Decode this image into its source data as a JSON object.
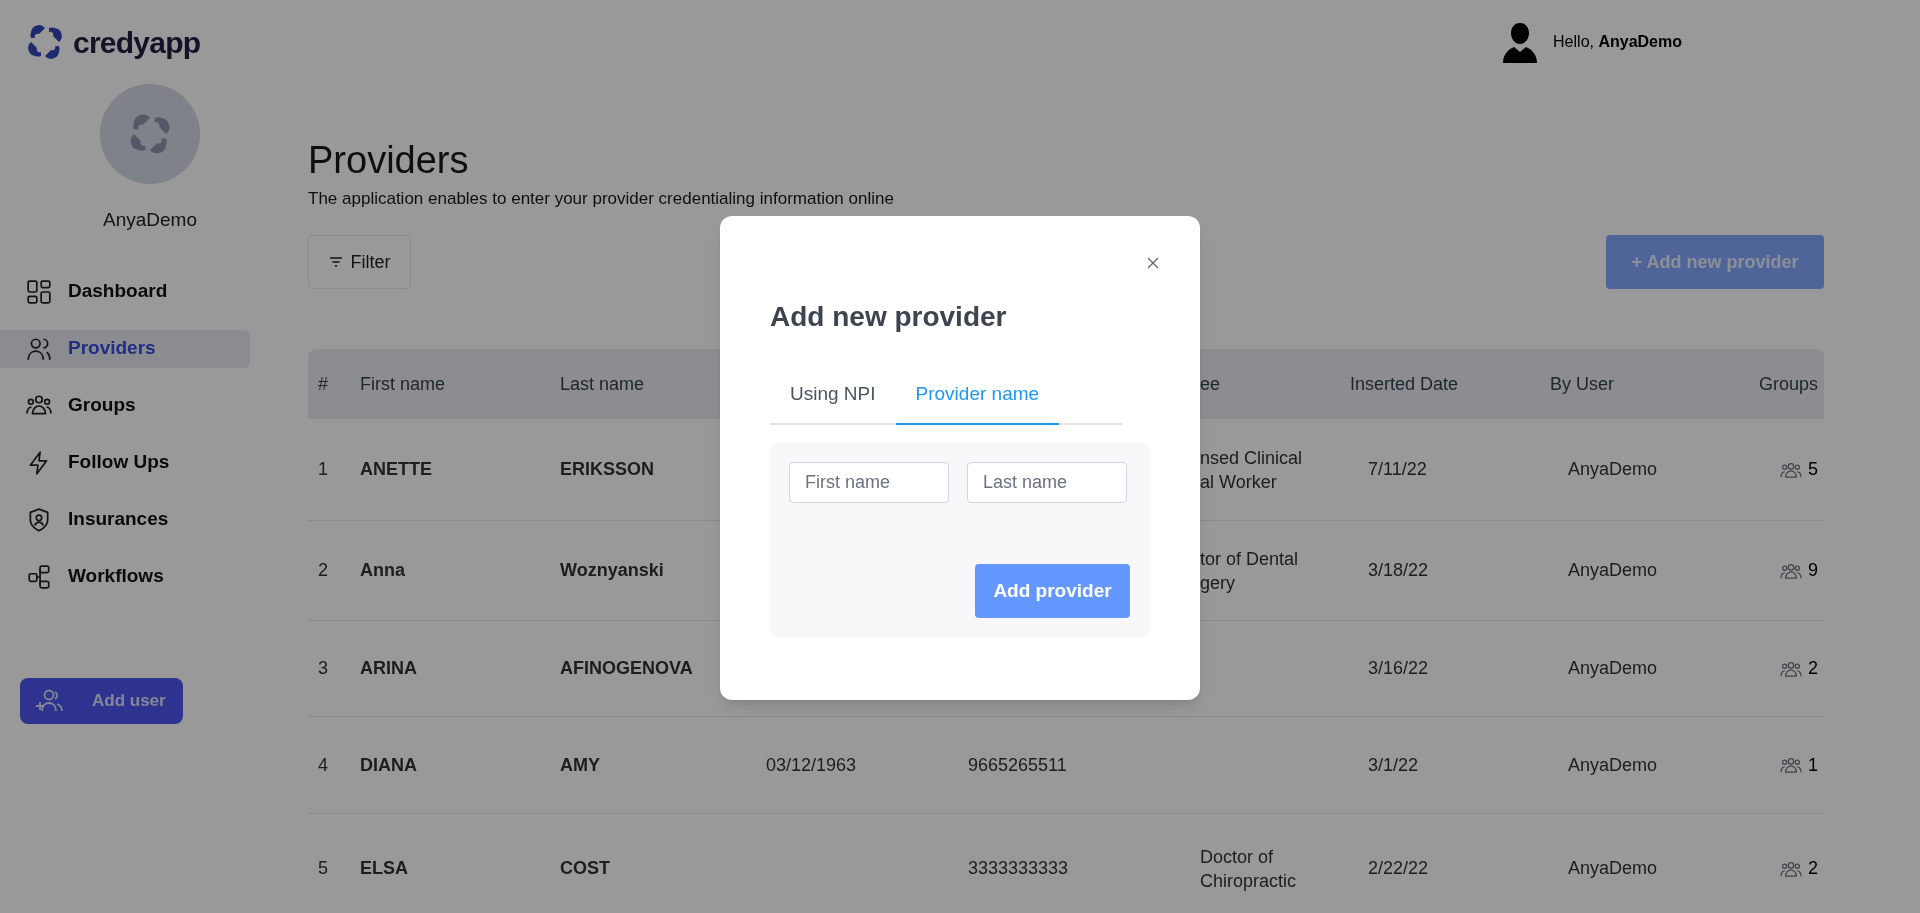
{
  "header": {
    "logo_text": "credyapp",
    "greeting": "Hello, **AnyaDemo**"
  },
  "sidebar": {
    "user_name": "AnyaDemo",
    "items": [
      {
        "label": "Dashboard",
        "selected": false
      },
      {
        "label": "Providers",
        "selected": true
      },
      {
        "label": "Groups",
        "selected": false
      },
      {
        "label": "Follow Ups",
        "selected": false
      },
      {
        "label": "Insurances",
        "selected": false
      },
      {
        "label": "Workflows",
        "selected": false
      }
    ],
    "add_user_button": "Add user"
  },
  "page": {
    "title": "Providers",
    "subtitle": "The application enables to enter your provider credentialing information online",
    "filter_button": "Filter",
    "add_button": "+ Add new provider"
  },
  "table": {
    "columns": {
      "number": "#",
      "first_name": "First name",
      "last_name": "Last name",
      "column_5": "ee",
      "inserted_date": "Inserted Date",
      "by_user": "By User",
      "groups": "Groups"
    },
    "rows": [
      {
        "number": "1",
        "first_name": "ANETTE",
        "last_name": "ERIKSSON",
        "column_5": [
          "nsed Clinical",
          "al Worker"
        ],
        "inserted_date": "7/11/22",
        "by_user": "AnyaDemo",
        "groups": "5"
      },
      {
        "number": "2",
        "first_name": "Anna",
        "last_name": "Woznyanski",
        "column_5": [
          "tor of Dental",
          "gery"
        ],
        "inserted_date": "3/18/22",
        "by_user": "AnyaDemo",
        "groups": "9"
      },
      {
        "number": "3",
        "first_name": "ARINA",
        "last_name": "AFINOGENOVA",
        "inserted_date": "3/16/22",
        "by_user": "AnyaDemo",
        "groups": "2"
      },
      {
        "number": "4",
        "first_name": "DIANA",
        "last_name": "AMY",
        "column_3": "03/12/1963",
        "column_4": "9665265511",
        "inserted_date": "3/1/22",
        "by_user": "AnyaDemo",
        "groups": "1"
      },
      {
        "number": "5",
        "first_name": "ELSA",
        "last_name": "COST",
        "column_4": "3333333333",
        "column_5": [
          "Doctor of",
          "Chiropractic"
        ],
        "inserted_date": "2/22/22",
        "by_user": "AnyaDemo",
        "groups": "2"
      }
    ]
  },
  "modal": {
    "title": "Add new provider",
    "tabs": [
      {
        "label": "Using NPI",
        "selected": false
      },
      {
        "label": "Provider name",
        "selected": true
      }
    ],
    "fields": [
      {
        "placeholder": "First name"
      },
      {
        "placeholder": "Last name"
      }
    ],
    "submit_button": "Add provider"
  }
}
